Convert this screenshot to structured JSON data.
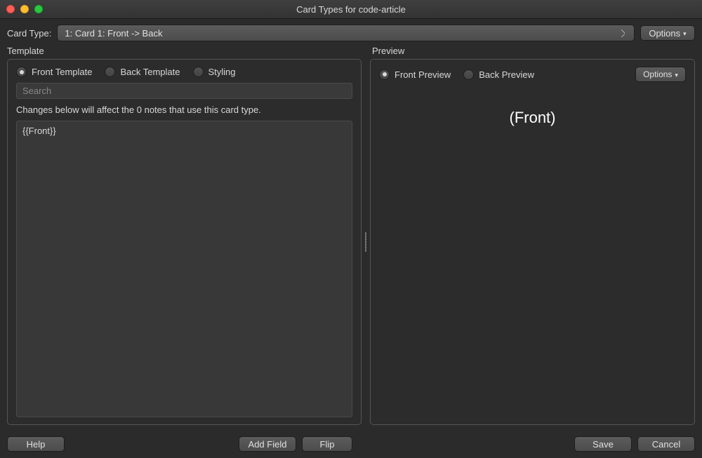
{
  "window": {
    "title": "Card Types for code-article"
  },
  "toprow": {
    "label": "Card Type:",
    "selected": "1: Card 1: Front -> Back",
    "options_label": "Options"
  },
  "template": {
    "heading": "Template",
    "radios": {
      "front": "Front Template",
      "back": "Back Template",
      "styling": "Styling"
    },
    "search_placeholder": "Search",
    "hint": "Changes below will affect the 0 notes that use this card type.",
    "editor_text": "{{Front}}"
  },
  "preview": {
    "heading": "Preview",
    "radios": {
      "front": "Front Preview",
      "back": "Back Preview"
    },
    "options_label": "Options",
    "content": "(Front)"
  },
  "buttons": {
    "help": "Help",
    "add_field": "Add Field",
    "flip": "Flip",
    "save": "Save",
    "cancel": "Cancel"
  }
}
